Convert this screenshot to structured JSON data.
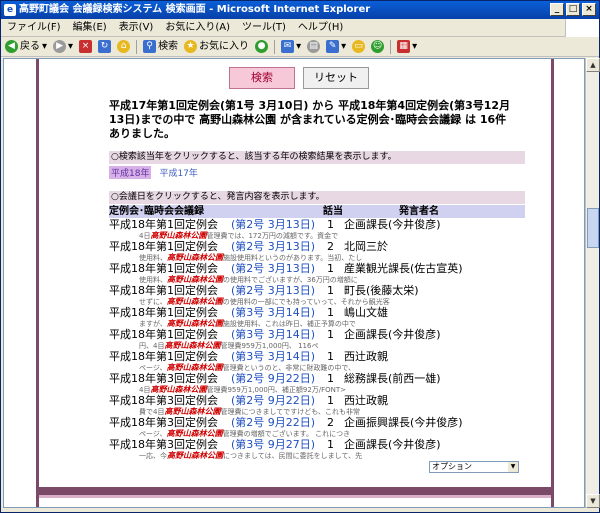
{
  "window": {
    "title": "高野町議会 会議録検索システム 検索画面 - Microsoft Internet Explorer",
    "app_icon": "ie-icon",
    "controls": [
      "_",
      "□",
      "×"
    ]
  },
  "menu": [
    "ファイル(F)",
    "編集(E)",
    "表示(V)",
    "お気に入り(A)",
    "ツール(T)",
    "ヘルプ(H)"
  ],
  "toolbar": {
    "back": "戻る",
    "search": "検索",
    "favorites": "お気に入り"
  },
  "buttons": {
    "search": "検索",
    "reset": "リセット"
  },
  "summary": "平成17年第1回定例会(第1号 3月10日) から 平成18年第4回定例会(第3号12月13日)までの中で 高野山森林公園 が含まれている定例会･臨時会会議録 は 16件 ありました。",
  "year_instruction": "○検索該当年をクリックすると、該当する年の検索結果を表示します。",
  "years": [
    "平成18年",
    "平成17年"
  ],
  "date_instruction": "○会議日をクリックすると、発言内容を表示します。",
  "table_header": {
    "session": "定例会･臨時会会議録",
    "turn": "話当",
    "speaker": "発言者名"
  },
  "keyword": "高野山森林公園",
  "results": [
    {
      "session": "平成18年第1回定例会",
      "date": "(第2号 3月13日)",
      "num": "1",
      "speaker": "企画課長(今井俊彦)",
      "pre": "4日",
      "post": "管理費では、172万円の減額です。資金で"
    },
    {
      "session": "平成18年第1回定例会",
      "date": "(第2号 3月13日)",
      "num": "2",
      "speaker": "北岡三於",
      "pre": "使用料、",
      "post": "施設使用料というのがあります。当初、たし"
    },
    {
      "session": "平成18年第1回定例会",
      "date": "(第2号 3月13日)",
      "num": "1",
      "speaker": "産業観光課長(佐古宣英)",
      "pre": "使用料、",
      "post": "の使用料でございますが、36万円の増額に"
    },
    {
      "session": "平成18年第1回定例会",
      "date": "(第2号 3月13日)",
      "num": "1",
      "speaker": "町長(後藤太栄)",
      "pre": "せずに、",
      "post": "の使用料の一部にでも持っていって、それから観光客"
    },
    {
      "session": "平成18年第1回定例会",
      "date": "(第3号 3月14日)",
      "num": "1",
      "speaker": "嶋山文雄",
      "pre": "ますが、",
      "post": "施設使用料、これは昨日、補正予算の中で"
    },
    {
      "session": "平成18年第1回定例会",
      "date": "(第3号 3月14日)",
      "num": "1",
      "speaker": "企画課長(今井俊彦)",
      "pre": "円、4目",
      "post": "管理費959万1,000円、 116ペ"
    },
    {
      "session": "平成18年第1回定例会",
      "date": "(第3号 3月14日)",
      "num": "1",
      "speaker": "西辻政親",
      "pre": "ページ、",
      "post": "管理費というのと、非常に財政難の中で、"
    },
    {
      "session": "平成18年第3回定例会",
      "date": "(第2号 9月22日)",
      "num": "1",
      "speaker": "総務課長(前西一雄)",
      "pre": "4目",
      "post": "管理費959万1,000円、補正額92万/FONT>"
    },
    {
      "session": "平成18年第3回定例会",
      "date": "(第2号 9月22日)",
      "num": "1",
      "speaker": "西辻政親",
      "pre": "費で4目",
      "post": "管理費につきましてですけども、これも非常"
    },
    {
      "session": "平成18年第3回定例会",
      "date": "(第2号 9月22日)",
      "num": "2",
      "speaker": "企画振興課長(今井俊彦)",
      "pre": "ページ、",
      "post": "管理費の増額でございます。 これにつき"
    },
    {
      "session": "平成18年第3回定例会",
      "date": "(第3号 9月27日)",
      "num": "1",
      "speaker": "企画課長(今井俊彦)",
      "pre": "一応、今",
      "post": "につきましては、民間に委託をしまして、先"
    }
  ],
  "option_select": "オプション"
}
